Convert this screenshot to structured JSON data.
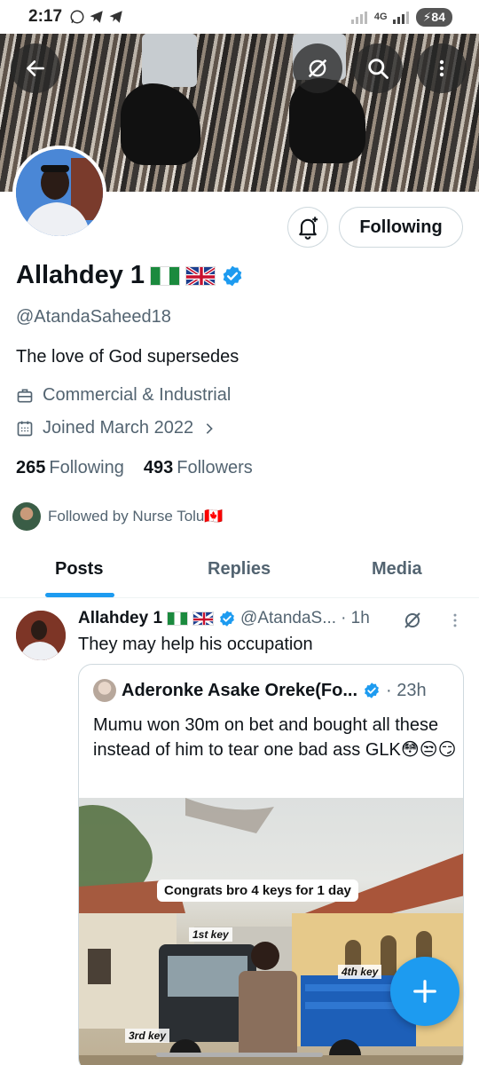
{
  "status_bar": {
    "time": "2:17",
    "network": "4G",
    "battery": "84"
  },
  "profile": {
    "name": "Allahdey 1",
    "handle": "@AtandaSaheed18",
    "bio": "The love of God supersedes",
    "category": "Commercial & Industrial",
    "joined": "Joined March 2022",
    "following_count": "265",
    "following_label": "Following",
    "followers_count": "493",
    "followers_label": "Followers",
    "followed_by": "Followed by Nurse Tolu🇨🇦"
  },
  "actions": {
    "following_button": "Following"
  },
  "tabs": [
    {
      "label": "Posts",
      "active": true
    },
    {
      "label": "Replies",
      "active": false
    },
    {
      "label": "Media",
      "active": false
    }
  ],
  "post": {
    "name": "Allahdey 1",
    "handle": "@AtandaS...",
    "time": "· 1h",
    "text": "They may help his occupation",
    "quote": {
      "name": "Aderonke Asake Oreke(Fo...",
      "time": "· 23h",
      "text": "Mumu won 30m on bet and bought all these instead of him to tear one bad ass GLK😳😒😏",
      "image_caption": "Congrats bro 4 keys for 1 day",
      "key_labels": [
        "1st key",
        "4th key",
        "3rd key"
      ]
    }
  },
  "colors": {
    "accent": "#1d9bf0",
    "text": "#0f1419",
    "muted": "#536471",
    "border": "#cfd9de"
  },
  "icons": [
    "back-arrow-icon",
    "grok-icon",
    "search-icon",
    "more-vertical-icon",
    "bell-plus-icon",
    "verified-badge-icon",
    "briefcase-icon",
    "calendar-icon",
    "chevron-right-icon",
    "plus-icon"
  ]
}
